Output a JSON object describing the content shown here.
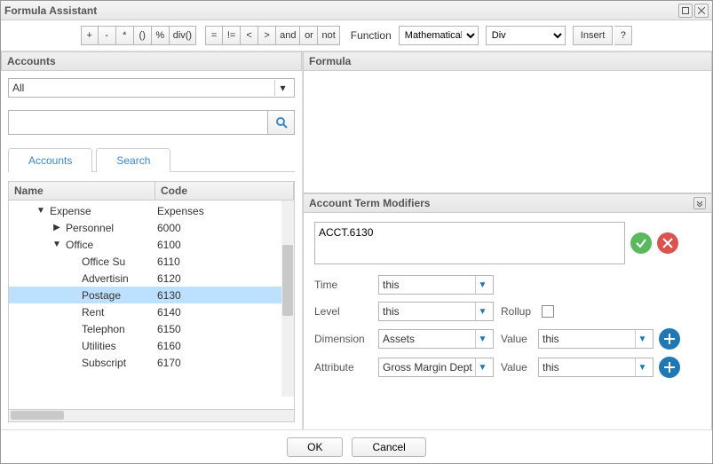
{
  "window": {
    "title": "Formula Assistant"
  },
  "toolbar": {
    "ops": [
      "+",
      "-",
      "*",
      "()",
      "%",
      "div()"
    ],
    "cmp": [
      "=",
      "!=",
      "<",
      ">",
      "and",
      "or",
      "not"
    ],
    "function_label": "Function",
    "function_category": "Mathematical",
    "function_name": "Div",
    "insert_label": "Insert",
    "help_label": "?"
  },
  "accounts_panel": {
    "title": "Accounts",
    "filter_value": "All",
    "search_value": "",
    "tabs": {
      "accounts": "Accounts",
      "search": "Search"
    },
    "grid_headers": {
      "name": "Name",
      "code": "Code"
    },
    "rows": [
      {
        "indent": 0,
        "toggle": "down",
        "name": "Expense",
        "code": "Expenses",
        "selected": false
      },
      {
        "indent": 1,
        "toggle": "right",
        "name": "Personnel",
        "code": "6000",
        "selected": false
      },
      {
        "indent": 1,
        "toggle": "down",
        "name": "Office",
        "code": "6100",
        "selected": false
      },
      {
        "indent": 2,
        "toggle": "",
        "name": "Office Su",
        "code": "6110",
        "selected": false
      },
      {
        "indent": 2,
        "toggle": "",
        "name": "Advertisin",
        "code": "6120",
        "selected": false
      },
      {
        "indent": 2,
        "toggle": "",
        "name": "Postage",
        "code": "6130",
        "selected": true
      },
      {
        "indent": 2,
        "toggle": "",
        "name": "Rent",
        "code": "6140",
        "selected": false
      },
      {
        "indent": 2,
        "toggle": "",
        "name": "Telephon",
        "code": "6150",
        "selected": false
      },
      {
        "indent": 2,
        "toggle": "",
        "name": "Utilities",
        "code": "6160",
        "selected": false
      },
      {
        "indent": 2,
        "toggle": "",
        "name": "Subscript",
        "code": "6170",
        "selected": false
      }
    ]
  },
  "formula_panel": {
    "title": "Formula",
    "value": ""
  },
  "modifiers": {
    "title": "Account Term Modifiers",
    "acct_value": "ACCT.6130",
    "rows": {
      "time_label": "Time",
      "time_value": "this",
      "level_label": "Level",
      "level_value": "this",
      "rollup_label": "Rollup",
      "dimension_label": "Dimension",
      "dimension_value": "Assets",
      "attribute_label": "Attribute",
      "attribute_value": "Gross Margin Dept",
      "value_label": "Value",
      "value_dim": "this",
      "value_attr": "this"
    }
  },
  "footer": {
    "ok": "OK",
    "cancel": "Cancel"
  }
}
